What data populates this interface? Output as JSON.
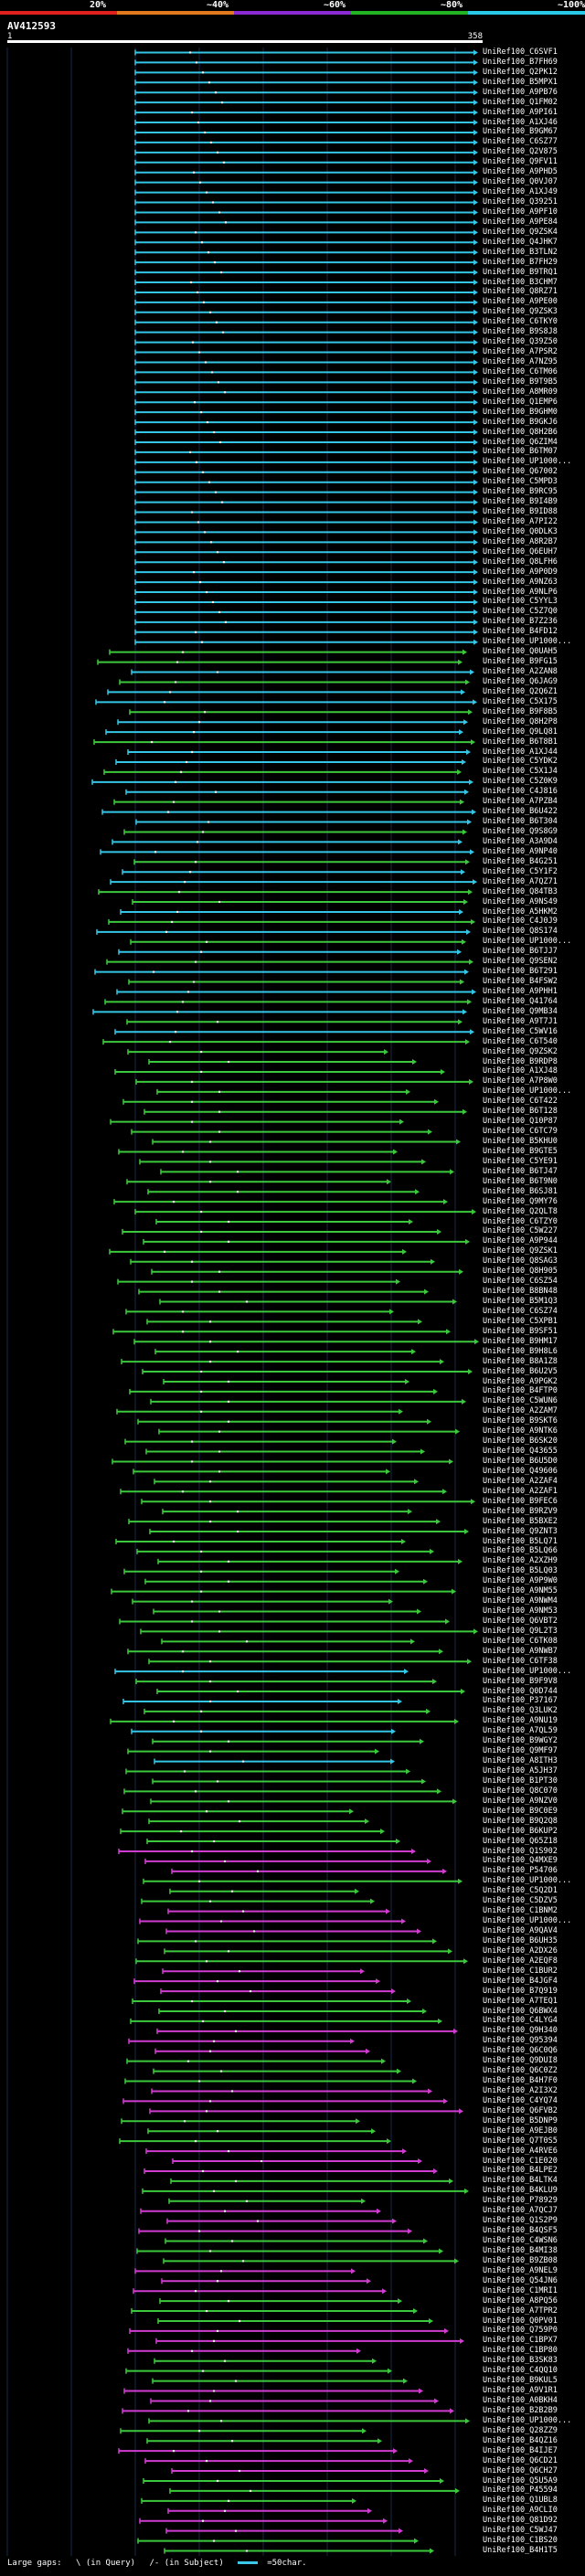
{
  "legend": {
    "labels": [
      "20%",
      "~40%",
      "~60%",
      "~80%",
      "~100%"
    ],
    "colors": [
      "#e0201c",
      "#e07a1c",
      "#8a2ad0",
      "#22b422",
      "#28c8e8"
    ]
  },
  "title": "AV412593",
  "ruler": {
    "start": "1",
    "end": "358"
  },
  "colors": {
    "cyan": "#34c6e6",
    "green": "#3cc83c",
    "magenta": "#d03cd0"
  },
  "hits": [
    "UniRef100_C6SVF1",
    "UniRef100_B7FH69",
    "UniRef100_Q2PK12",
    "UniRef100_B5MPX1",
    "UniRef100_A9PB76",
    "UniRef100_Q1FM02",
    "UniRef100_A9PI61",
    "UniRef100_A1XJ46",
    "UniRef100_B9GM67",
    "UniRef100_C6SZ77",
    "UniRef100_Q2V875",
    "UniRef100_Q9FV11",
    "UniRef100_A9PHD5",
    "UniRef100_Q0VJ07",
    "UniRef100_A1XJ49",
    "UniRef100_Q39251",
    "UniRef100_A9PF10",
    "UniRef100_A9PE84",
    "UniRef100_Q9ZSK4",
    "UniRef100_Q4JHK7",
    "UniRef100_B3TLN2",
    "UniRef100_B7FH29",
    "UniRef100_B9TRQ1",
    "UniRef100_B3CHM7",
    "UniRef100_Q8RZ71",
    "UniRef100_A9PE00",
    "UniRef100_Q9ZSK3",
    "UniRef100_C6TKY0",
    "UniRef100_B9S8J8",
    "UniRef100_Q39Z50",
    "UniRef100_A7PSR2",
    "UniRef100_A7NZ95",
    "UniRef100_C6TM06",
    "UniRef100_B9T9B5",
    "UniRef100_A8MR09",
    "UniRef100_Q1EMP6",
    "UniRef100_B9GHM0",
    "UniRef100_B9GKJ6",
    "UniRef100_Q8H2B6",
    "UniRef100_Q6ZIM4",
    "UniRef100_B6TM07",
    "UniRef100_UP1000...",
    "UniRef100_Q67002",
    "UniRef100_C5MPD3",
    "UniRef100_B9RC95",
    "UniRef100_B9I4B9",
    "UniRef100_B9ID88",
    "UniRef100_A7PI22",
    "UniRef100_Q0DLK3",
    "UniRef100_A8R2B7",
    "UniRef100_Q6EUH7",
    "UniRef100_Q8LFH6",
    "UniRef100_A9P0D9",
    "UniRef100_A9NZ63",
    "UniRef100_A9NLP6",
    "UniRef100_C5YYL3",
    "UniRef100_C5Z7Q0",
    "UniRef100_B7Z236",
    "UniRef100_B4FD12",
    "UniRef100_UP1000...",
    "UniRef100_Q0UAH5",
    "UniRef100_B9FG15",
    "UniRef100_A2ZAN8",
    "UniRef100_Q6JAG9",
    "UniRef100_Q2Q6Z1",
    "UniRef100_C5X175",
    "UniRef100_B9F8B5",
    "UniRef100_Q8H2P8",
    "UniRef100_Q9LQ81",
    "UniRef100_B6T8B1",
    "UniRef100_A1XJ44",
    "UniRef100_C5YDK2",
    "UniRef100_C5X1J4",
    "UniRef100_C5Z0K9",
    "UniRef100_C4J816",
    "UniRef100_A7PZB4",
    "UniRef100_B6U422",
    "UniRef100_B6T304",
    "UniRef100_Q9S8G9",
    "UniRef100_A3A9D4",
    "UniRef100_A9NP40",
    "UniRef100_B4G251",
    "UniRef100_C5Y1F2",
    "UniRef100_A7QZ71",
    "UniRef100_Q84TB3",
    "UniRef100_A9NS49",
    "UniRef100_A5HKM2",
    "UniRef100_C4J0J9",
    "UniRef100_Q8S174",
    "UniRef100_UP1000...",
    "UniRef100_B6TJJ7",
    "UniRef100_Q9SEN2",
    "UniRef100_B6T291",
    "UniRef100_B4FSW2",
    "UniRef100_A9PHH1",
    "UniRef100_Q41764",
    "UniRef100_Q9MB34",
    "UniRef100_A9T7J1",
    "UniRef100_C5WV16",
    "UniRef100_C6T540",
    "UniRef100_Q9ZSK2",
    "UniRef100_B9RDP8",
    "UniRef100_A1XJ48",
    "UniRef100_A7P8W0",
    "UniRef100_UP1000...",
    "UniRef100_C6T422",
    "UniRef100_B6T128",
    "UniRef100_Q10P87",
    "UniRef100_C6TC79",
    "UniRef100_B5KHU0",
    "UniRef100_B9GTE5",
    "UniRef100_C5YE91",
    "UniRef100_B6TJ47",
    "UniRef100_B6T9N0",
    "UniRef100_B6SJ81",
    "UniRef100_Q9MY76",
    "UniRef100_Q2QLT8",
    "UniRef100_C6TZY0",
    "UniRef100_C5W227",
    "UniRef100_A9P944",
    "UniRef100_Q9ZSK1",
    "UniRef100_Q8SAG3",
    "UniRef100_Q8H905",
    "UniRef100_C6SZ54",
    "UniRef100_B8BN48",
    "UniRef100_B5M1Q3",
    "UniRef100_C6SZ74",
    "UniRef100_C5XPB1",
    "UniRef100_B9SF51",
    "UniRef100_B9HM17",
    "UniRef100_B9H8L6",
    "UniRef100_B8A1Z8",
    "UniRef100_B6U2V5",
    "UniRef100_A9PGK2",
    "UniRef100_B4FTP0",
    "UniRef100_C5WUN6",
    "UniRef100_A2ZAM7",
    "UniRef100_B9SKT6",
    "UniRef100_A9NTK6",
    "UniRef100_B6SK20",
    "UniRef100_Q43655",
    "UniRef100_B6U5D0",
    "UniRef100_Q49606",
    "UniRef100_A2ZAF4",
    "UniRef100_A2ZAF1",
    "UniRef100_B9FEC6",
    "UniRef100_B9RZV9",
    "UniRef100_B5BXE2",
    "UniRef100_Q9ZNT3",
    "UniRef100_B5LQ71",
    "UniRef100_B5LQ66",
    "UniRef100_A2XZH9",
    "UniRef100_B5LQ03",
    "UniRef100_A9P9W0",
    "UniRef100_A9NM55",
    "UniRef100_A9NWM4",
    "UniRef100_A9NM53",
    "UniRef100_Q6VBT2",
    "UniRef100_Q9L2T3",
    "UniRef100_C6TK08",
    "UniRef100_A9NWB7",
    "UniRef100_C6TF38",
    "UniRef100_UP1000...",
    "UniRef100_B9F9V8",
    "UniRef100_Q0D744",
    "UniRef100_P37167",
    "UniRef100_Q3LUK2",
    "UniRef100_A9NU19",
    "UniRef100_A7QL59",
    "UniRef100_B9WGY2",
    "UniRef100_Q9MF97",
    "UniRef100_A8ITH3",
    "UniRef100_A5JH37",
    "UniRef100_B1PT30",
    "UniRef100_Q8C070",
    "UniRef100_A9NZV0",
    "UniRef100_B9C0E9",
    "UniRef100_B9Q2Q8",
    "UniRef100_B6KUP2",
    "UniRef100_Q65Z18",
    "UniRef100_Q1S902",
    "UniRef100_Q4MXE9",
    "UniRef100_P54706",
    "UniRef100_UP1000...",
    "UniRef100_C5Q2D1",
    "UniRef100_C5DZV5",
    "UniRef100_C1BNM2",
    "UniRef100_UP1000...",
    "UniRef100_A9QAV4",
    "UniRef100_B6UH35",
    "UniRef100_A2DX26",
    "UniRef100_A2EQF8",
    "UniRef100_C1BUR2",
    "UniRef100_B4JGF4",
    "UniRef100_B7Q919",
    "UniRef100_A7TEQ1",
    "UniRef100_Q6BWX4",
    "UniRef100_C4LYG4",
    "UniRef100_Q9H340",
    "UniRef100_Q95394",
    "UniRef100_Q6C0Q6",
    "UniRef100_Q9DUI8",
    "UniRef100_Q6C0Z2",
    "UniRef100_B4H7F0",
    "UniRef100_A2I3X2",
    "UniRef100_C4YQ74",
    "UniRef100_Q6FVB2",
    "UniRef100_B5DNP9",
    "UniRef100_A9EJB0",
    "UniRef100_Q7T0S5",
    "UniRef100_A4RVE6",
    "UniRef100_C1E020",
    "UniRef100_B4LPE2",
    "UniRef100_B4LTK4",
    "UniRef100_B4KLU9",
    "UniRef100_P78929",
    "UniRef100_A7QCJ7",
    "UniRef100_Q1S2P9",
    "UniRef100_B4QSF5",
    "UniRef100_C4WSN6",
    "UniRef100_B4MI38",
    "UniRef100_B9ZB08",
    "UniRef100_A9NEL9",
    "UniRef100_Q54JN6",
    "UniRef100_C1MRI1",
    "UniRef100_A8PQ56",
    "UniRef100_A7TPR2",
    "UniRef100_Q0PV01",
    "UniRef100_Q759P0",
    "UniRef100_C1BPX7",
    "UniRef100_C1BP80",
    "UniRef100_B3SK83",
    "UniRef100_C4QQ10",
    "UniRef100_B9KUL5",
    "UniRef100_A9V1R1",
    "UniRef100_A0BKH4",
    "UniRef100_B2B2B9",
    "UniRef100_UP1000...",
    "UniRef100_Q28ZZ9",
    "UniRef100_B4QZ16",
    "UniRef100_B4IJE7",
    "UniRef100_Q6CD21",
    "UniRef100_Q6CH27",
    "UniRef100_Q5U5A9",
    "UniRef100_P45594",
    "UniRef100_Q1UBL8",
    "UniRef100_A9CLI0",
    "UniRef100_Q81D92",
    "UniRef100_C5WJ47",
    "UniRef100_C1BS20",
    "UniRef100_B4H1T5"
  ],
  "footer": {
    "gaps_label": "Large gaps:",
    "query_gap": "\\ (in Query)",
    "subject_gap": "/- (in Subject)",
    "scale": "=50char."
  }
}
